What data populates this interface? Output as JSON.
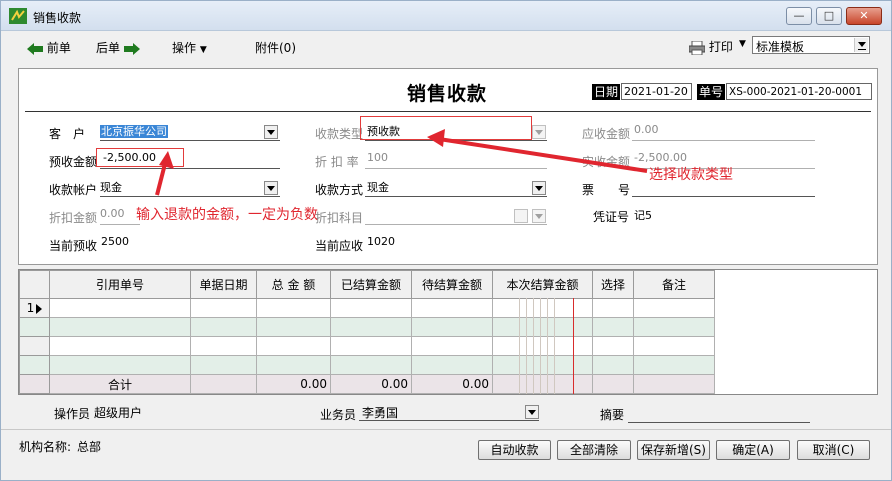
{
  "window": {
    "title": "销售收款",
    "controls": [
      "—",
      "□",
      "✕"
    ]
  },
  "toolbar": {
    "prev_label": "前单",
    "next_label": "后单",
    "ops_label": "操作",
    "attach_label": "附件(0)",
    "print_label": "打印",
    "template_value": "标准模板"
  },
  "form": {
    "title": "销售收款",
    "date_tag": "日期",
    "date_value": "2021-01-20",
    "docno_tag": "单号",
    "docno_value": "XS-000-2021-01-20-0001",
    "customer_label": "客　户",
    "customer_value": "北京振华公司",
    "collect_type_label": "收款类型",
    "collect_type_value": "预收款",
    "receivable_label": "应收金额",
    "receivable_value": "0.00",
    "prepaid_label": "预收金额",
    "prepaid_value": "-2,500.00",
    "discount_rate_label": "折 扣 率",
    "discount_rate_value": "100",
    "actual_label": "实收金额",
    "actual_value": "-2,500.00",
    "account_label": "收款帐户",
    "account_value": "现金",
    "method_label": "收款方式",
    "method_value": "现金",
    "ticket_label": "票　　号",
    "ticket_value": "",
    "discount_amt_label": "折扣金额",
    "discount_amt_value": "0.00",
    "discount_subject_label": "折扣科目",
    "voucher_label": "凭证号",
    "voucher_value": "记5",
    "current_prepaid_label": "当前预收",
    "current_prepaid_value": "2500",
    "current_receivable_label": "当前应收",
    "current_receivable_value": "1020"
  },
  "annotations": {
    "enter_refund": "输入退款的金额，一定为负数",
    "choose_type": "选择收款类型"
  },
  "grid": {
    "columns": [
      "引用单号",
      "单据日期",
      "总 金 额",
      "已结算金额",
      "待结算金额",
      "本次结算金额",
      "选择",
      "备注"
    ],
    "rows": [
      {
        "num": "1",
        "cells": [
          "",
          "",
          "",
          "",
          "",
          "",
          "",
          ""
        ]
      },
      {
        "num": "",
        "cells": [
          "",
          "",
          "",
          "",
          "",
          "",
          "",
          ""
        ]
      },
      {
        "num": "",
        "cells": [
          "",
          "",
          "",
          "",
          "",
          "",
          "",
          ""
        ]
      },
      {
        "num": "",
        "cells": [
          "",
          "",
          "",
          "",
          "",
          "",
          "",
          ""
        ]
      }
    ],
    "total": {
      "label": "合计",
      "total_amount": "0.00",
      "settled": "0.00",
      "pending": "0.00"
    }
  },
  "footer": {
    "operator_label": "操作员",
    "operator_value": "超级用户",
    "salesman_label": "业务员",
    "salesman_value": "李勇国",
    "summary_label": "摘要",
    "summary_value": "",
    "org_label": "机构名称:",
    "org_value": "总部",
    "buttons": {
      "auto": "自动收款",
      "clear": "全部清除",
      "save_new": "保存新增(S)",
      "ok": "确定(A)",
      "cancel": "取消(C)"
    }
  },
  "colors": {
    "annotation": "#e0262f",
    "selection": "#3a86d6",
    "row_alt": "#e3efe8",
    "total_row": "#ebe4e8"
  }
}
